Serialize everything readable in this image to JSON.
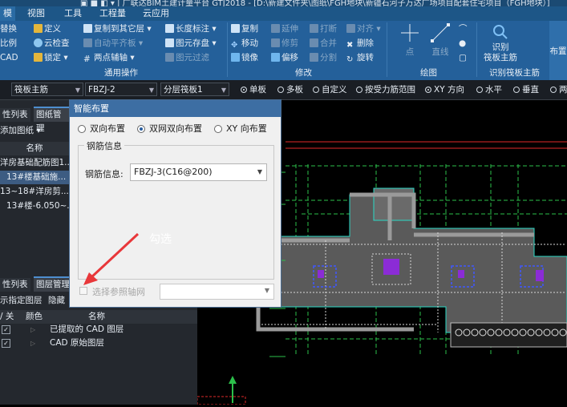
{
  "titlebar": {
    "text": "▣  ■  ◧  ▾  |  广联达BIM土建计量平台 GTJ2018 - [D:\\新建文件夹\\图纸\\FGH地块\\新疆石河子万达广场项目配套住宅项目（FGH地块）]"
  },
  "menu": [
    "模",
    "视图",
    "工具",
    "工程量",
    "云应用"
  ],
  "ribbon": {
    "col1": [
      "替换",
      "比例",
      "CAD"
    ],
    "col2": [
      "定义",
      "云检查",
      "锁定"
    ],
    "col3": [
      "复制到其它层",
      "自动平齐板",
      "两点辅轴"
    ],
    "col4": [
      "长度标注",
      "图元存盘",
      "图元过滤"
    ],
    "modify_col1": [
      "复制",
      "移动",
      "镜像"
    ],
    "modify_col2": [
      "延伸",
      "修剪",
      "偏移"
    ],
    "modify_col3": [
      "打断",
      "合并",
      "分割"
    ],
    "modify_col4": [
      "对齐",
      "删除",
      "旋转"
    ],
    "draw_labels": [
      "点",
      "直线"
    ],
    "identify_btn": "识别\n筏板主筋",
    "layout_btn": "布置",
    "groups": {
      "general": "通用操作",
      "modify": "修改",
      "draw": "绘图",
      "identify": "识别筏板主筋"
    }
  },
  "toolbar": {
    "combo1": "筏板主筋",
    "combo2": "FBZJ-2",
    "combo3": "分层筏板1",
    "radios": [
      {
        "label": "单板",
        "on": true
      },
      {
        "label": "多板",
        "on": false
      },
      {
        "label": "自定义",
        "on": false
      },
      {
        "label": "按受力筋范围",
        "on": false
      },
      {
        "label": "XY 方向",
        "on": true
      },
      {
        "label": "水平",
        "on": false
      },
      {
        "label": "垂直",
        "on": false
      },
      {
        "label": "两",
        "on": false
      }
    ]
  },
  "leftpanel": {
    "tabs": [
      "性列表",
      "图纸管理"
    ],
    "add_btn": "添加图纸",
    "header": "名称",
    "rows": [
      "洋房基础配筋图1...",
      "13#楼基础施...",
      "13~18#洋房剪...",
      "13#楼-6.050~..."
    ]
  },
  "layerpanel": {
    "tabs": [
      "性列表",
      "图层管理"
    ],
    "options": [
      "示指定图层",
      "隐藏"
    ],
    "headers": [
      "/ 关",
      "颜色",
      "名称"
    ],
    "rows": [
      {
        "name": "已提取的 CAD 图层"
      },
      {
        "name": "CAD 原始图层"
      }
    ]
  },
  "dialog": {
    "title": "智能布置",
    "modes": [
      {
        "label": "双向布置",
        "on": false
      },
      {
        "label": "双网双向布置",
        "on": true
      },
      {
        "label": "XY 向布置",
        "on": false
      }
    ],
    "group_title": "钢筋信息",
    "rebar_label": "钢筋信息:",
    "rebar_value": "FBZJ-3(C16@200)",
    "axis_label": "选择参照轴网",
    "axis_value": ""
  },
  "annotation": "勾选",
  "colors": {
    "ribbon": "#24609a",
    "dialog_title": "#3d6ea3",
    "arrow": "#e8373a"
  }
}
